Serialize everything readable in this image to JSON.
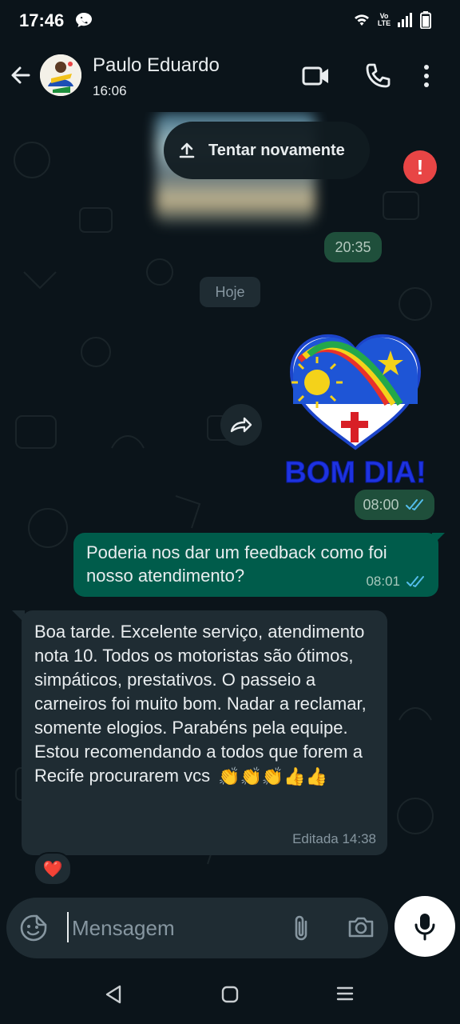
{
  "status_bar": {
    "time": "17:46",
    "network_label": "Vo LTE"
  },
  "header": {
    "contact_name": "Paulo Eduardo",
    "subtitle": "16:06"
  },
  "chat": {
    "retry_label": "Tentar novamente",
    "sent_image_time": "20:35",
    "date_chip": "Hoje",
    "sticker": {
      "text": "BOM DIA!",
      "time": "08:00"
    },
    "outgoing_message": {
      "text": "Poderia nos dar um feedback como foi nosso atendimento?",
      "time": "08:01"
    },
    "incoming_message": {
      "text": "Boa tarde. Excelente serviço, atendimento nota 10. Todos os motoristas são ótimos,  simpáticos, prestativos. O passeio a  carneiros foi muito bom.   Nadar a reclamar, somente elogios. Parabéns pela equipe.  Estou recomendando a todos que forem a Recife procurarem vcs",
      "emojis": "👏👏👏👍👍",
      "meta": "Editada 14:38",
      "reaction": "❤️"
    }
  },
  "composer": {
    "placeholder": "Mensagem"
  },
  "colors": {
    "outgoing_bubble": "#005c4b",
    "incoming_bubble": "#1f2c33",
    "background": "#0b141a",
    "read_ticks": "#53bdeb",
    "error": "#e84545"
  }
}
